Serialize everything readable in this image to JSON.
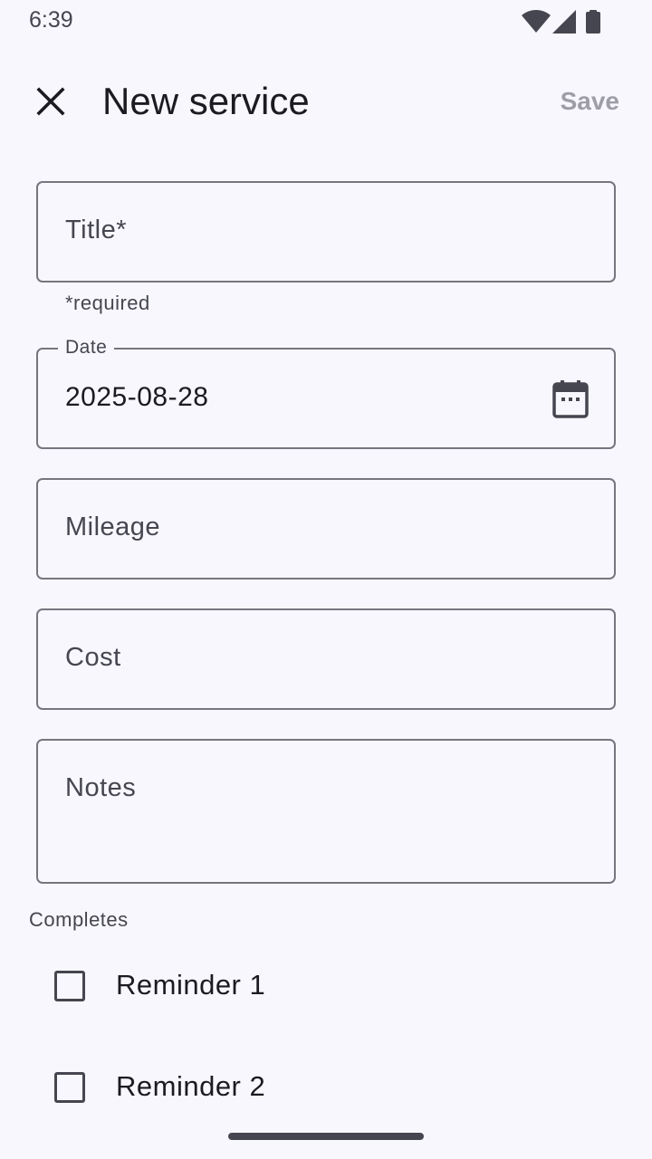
{
  "status_bar": {
    "time": "6:39",
    "icons": [
      "wifi-icon",
      "cell-signal-icon",
      "battery-icon"
    ]
  },
  "app_bar": {
    "close_icon": "close-icon",
    "title": "New service",
    "save_label": "Save"
  },
  "form": {
    "title_field": {
      "placeholder": "Title*",
      "helper": "*required"
    },
    "date_field": {
      "label": "Date",
      "value": "2025-08-28",
      "icon": "calendar-icon"
    },
    "mileage_field": {
      "placeholder": "Mileage"
    },
    "cost_field": {
      "placeholder": "Cost"
    },
    "notes_field": {
      "placeholder": "Notes"
    }
  },
  "completes": {
    "label": "Completes",
    "items": [
      {
        "label": "Reminder 1",
        "checked": false
      },
      {
        "label": "Reminder 2",
        "checked": false
      }
    ]
  },
  "colors": {
    "background": "#f8f7fd",
    "outline": "#76767f",
    "text": "#1b1b21",
    "secondary_text": "#45464f",
    "disabled": "#9e9ea6"
  }
}
